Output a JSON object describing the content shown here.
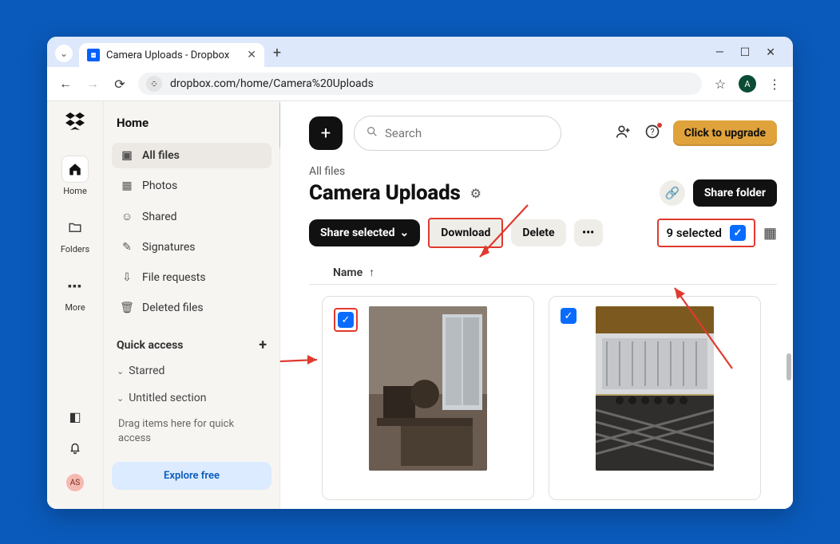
{
  "browser": {
    "tab_title": "Camera Uploads - Dropbox",
    "url": "dropbox.com/home/Camera%20Uploads",
    "profile_initial": "A"
  },
  "rail": {
    "items": [
      {
        "label": "Home"
      },
      {
        "label": "Folders"
      },
      {
        "label": "More"
      }
    ],
    "mini_avatar": "AS"
  },
  "sidebar": {
    "heading": "Home",
    "items": [
      {
        "label": "All files"
      },
      {
        "label": "Photos"
      },
      {
        "label": "Shared"
      },
      {
        "label": "Signatures"
      },
      {
        "label": "File requests"
      },
      {
        "label": "Deleted files"
      }
    ],
    "quick_access_label": "Quick access",
    "starred_label": "Starred",
    "untitled_label": "Untitled section",
    "hint": "Drag items here for quick access",
    "explore": "Explore free"
  },
  "main": {
    "search_placeholder": "Search",
    "upgrade_label": "Click to upgrade",
    "breadcrumb": "All files",
    "page_title": "Camera Uploads",
    "share_folder_label": "Share folder",
    "actions": {
      "share_selected": "Share selected",
      "download": "Download",
      "delete": "Delete",
      "selected_count": "9 selected"
    },
    "column_name": "Name"
  }
}
